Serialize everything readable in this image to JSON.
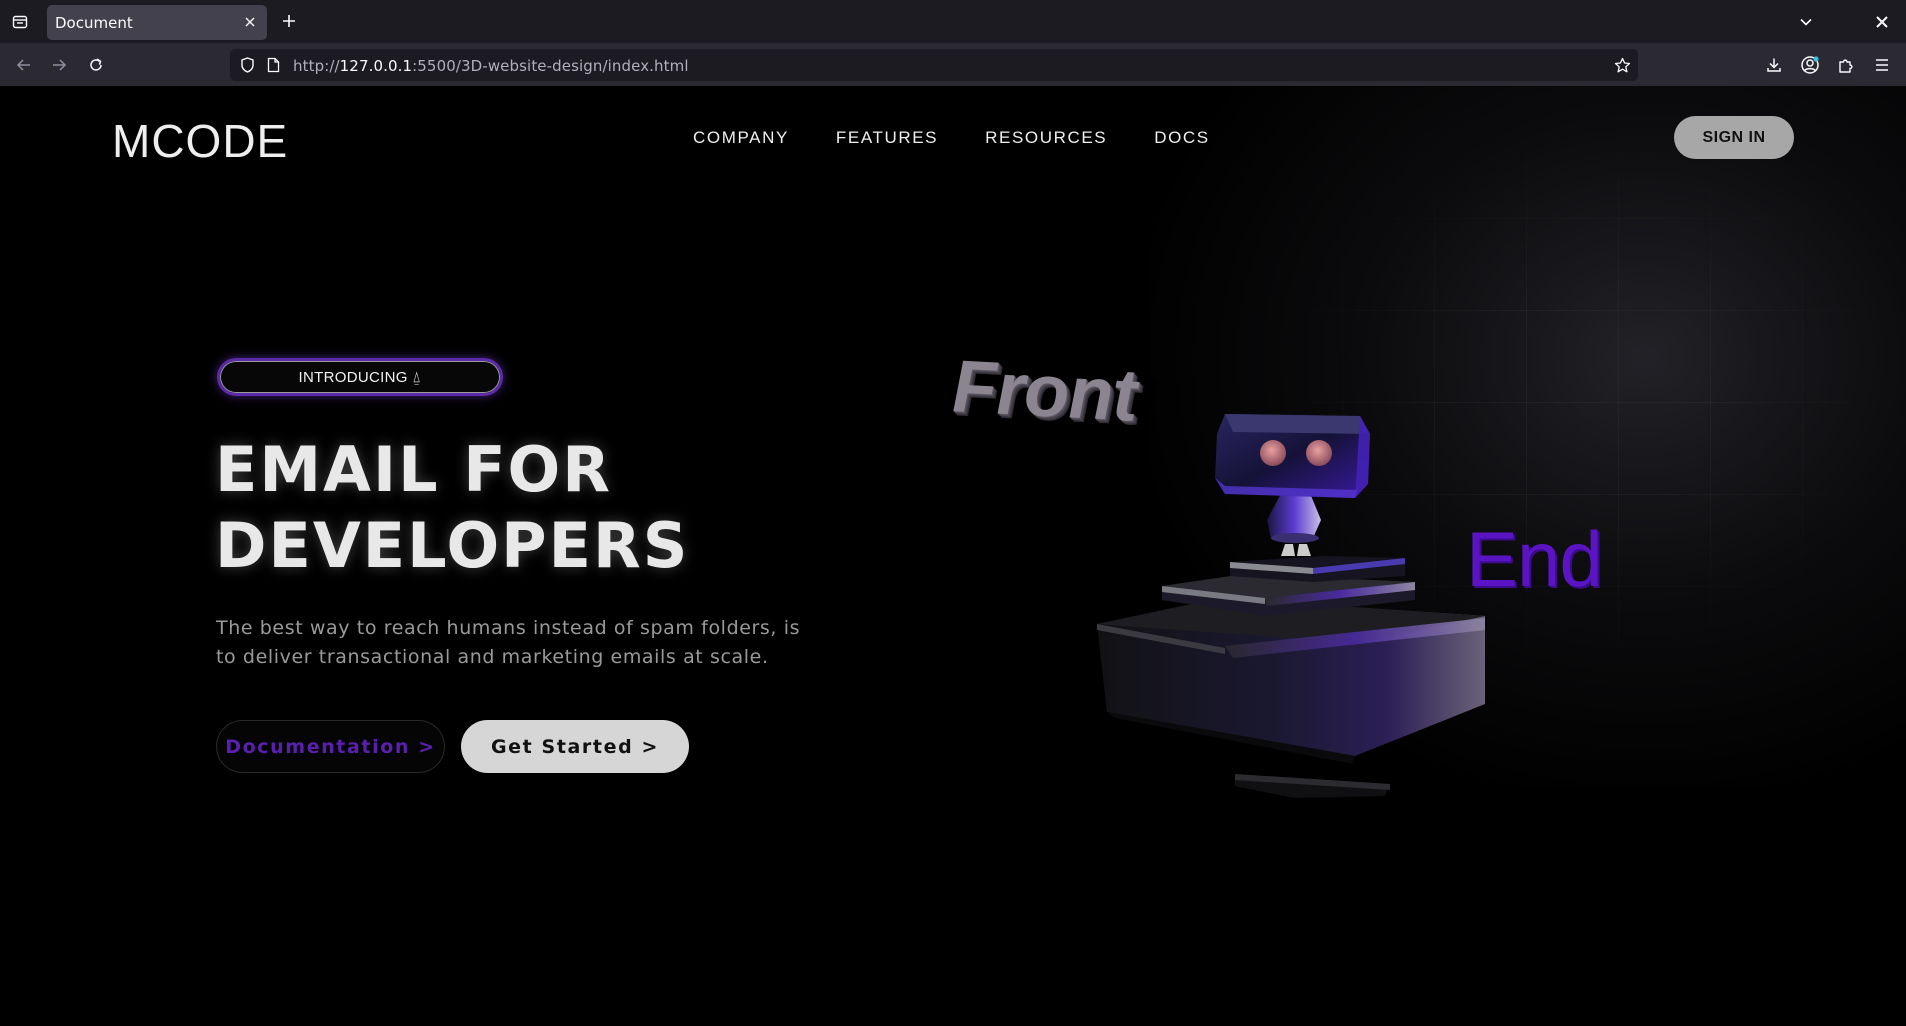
{
  "browser": {
    "tab": {
      "title": "Document"
    },
    "url": {
      "prefix": "http://",
      "host": "127.0.0.1",
      "rest": ":5500/3D-website-design/index.html"
    }
  },
  "site": {
    "logo": "MCODE",
    "nav": {
      "items": [
        {
          "label": "COMPANY"
        },
        {
          "label": "FEATURES"
        },
        {
          "label": "RESOURCES"
        },
        {
          "label": "DOCS"
        }
      ],
      "sign_in": "SIGN IN"
    },
    "hero": {
      "badge": "INTRODUCING ⍙",
      "title_line1": "EMAIL FOR",
      "title_line2": "DEVELOPERS",
      "description": "The best way to reach humans instead of spam folders, is to deliver transactional and marketing emails at scale.",
      "buttons": {
        "documentation": "Documentation >",
        "get_started": "Get Started >"
      }
    },
    "scene": {
      "word_front": "Front",
      "word_end": "End"
    }
  },
  "colors": {
    "accent_purple": "#5a14c4",
    "badge_border": "#5b2aa8",
    "signin_bg": "#a7a7a7",
    "get_started_bg": "#d6d6d6",
    "page_bg": "#000000"
  },
  "icons": {
    "tab_list": "tab-list-icon",
    "tab_close": "close-icon",
    "new_tab": "plus-icon",
    "back": "back-arrow-icon",
    "forward": "forward-arrow-icon",
    "reload": "reload-icon",
    "shield": "shield-icon",
    "page": "page-icon",
    "bookmark": "star-icon",
    "downloads": "download-icon",
    "account": "account-icon",
    "extensions": "extensions-icon",
    "menu": "hamburger-menu-icon"
  }
}
